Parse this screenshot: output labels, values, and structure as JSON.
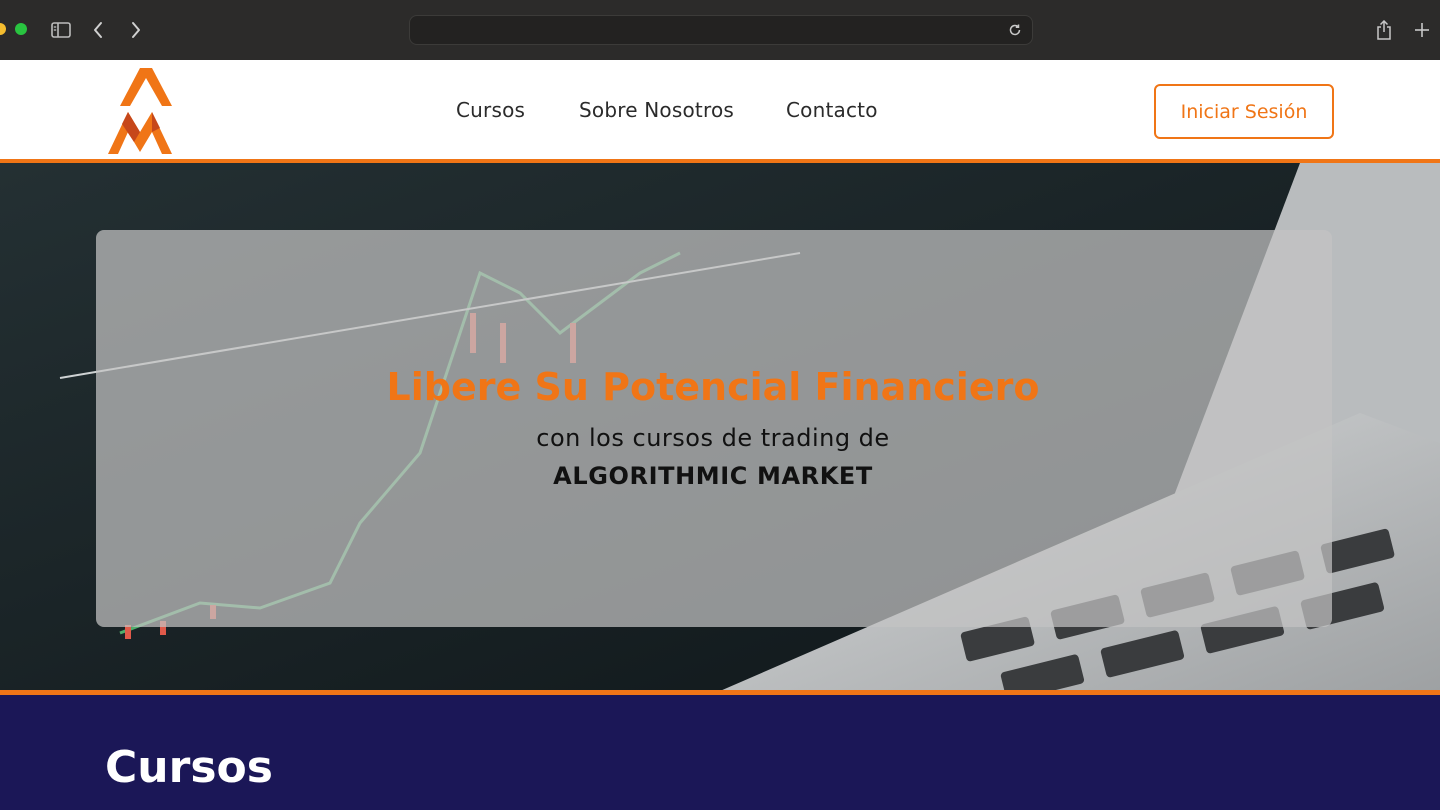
{
  "browser": {
    "url": "",
    "icons": [
      "sidebar-icon",
      "back-icon",
      "forward-icon",
      "reload-icon",
      "share-icon",
      "new-tab-icon"
    ]
  },
  "header": {
    "nav": [
      "Cursos",
      "Sobre Nosotros",
      "Contacto"
    ],
    "login_label": "Iniciar Sesión",
    "accent_color": "#f07516"
  },
  "hero": {
    "title": "Libere Su Potencial Financiero",
    "subtitle": "con los cursos de trading de",
    "brand": "ALGORITHMIC MARKET"
  },
  "section": {
    "title": "Cursos",
    "background_color": "#1b1757"
  }
}
